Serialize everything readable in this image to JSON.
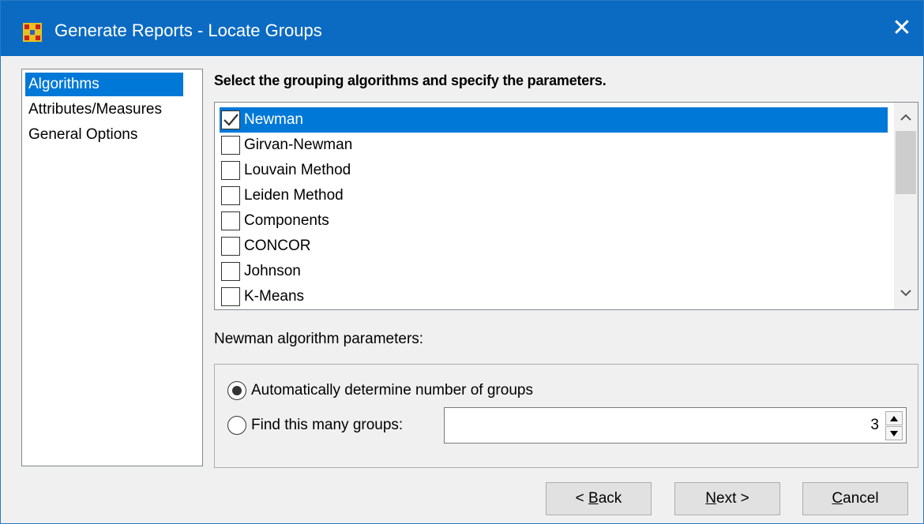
{
  "window": {
    "title": "Generate Reports - Locate Groups",
    "close_label": "✕",
    "app_icon": "ora-grid-icon"
  },
  "nav": {
    "items": [
      {
        "label": "Algorithms",
        "selected": true
      },
      {
        "label": "Attributes/Measures",
        "selected": false
      },
      {
        "label": "General Options",
        "selected": false
      }
    ]
  },
  "main": {
    "heading": "Select the grouping algorithms and specify the parameters.",
    "algorithms": [
      {
        "label": "Newman",
        "checked": true,
        "selected": true
      },
      {
        "label": "Girvan-Newman",
        "checked": false,
        "selected": false
      },
      {
        "label": "Louvain Method",
        "checked": false,
        "selected": false
      },
      {
        "label": "Leiden Method",
        "checked": false,
        "selected": false
      },
      {
        "label": "Components",
        "checked": false,
        "selected": false
      },
      {
        "label": "CONCOR",
        "checked": false,
        "selected": false
      },
      {
        "label": "Johnson",
        "checked": false,
        "selected": false
      },
      {
        "label": "K-Means",
        "checked": false,
        "selected": false
      }
    ],
    "params_label": "Newman algorithm parameters:",
    "options": {
      "auto_label": "Automatically determine number of groups",
      "auto_selected": true,
      "find_label": "Find this many groups:",
      "find_selected": false,
      "groups_value": "3"
    }
  },
  "buttons": {
    "back_prefix": "< ",
    "back_mnemonic": "B",
    "back_rest": "ack",
    "next_mnemonic": "N",
    "next_rest": "ext >",
    "cancel_mnemonic": "C",
    "cancel_rest": "ancel"
  },
  "colors": {
    "titlebar": "#0b6bc3",
    "selection": "#0078d7",
    "dialog_bg": "#f0f0f0"
  }
}
